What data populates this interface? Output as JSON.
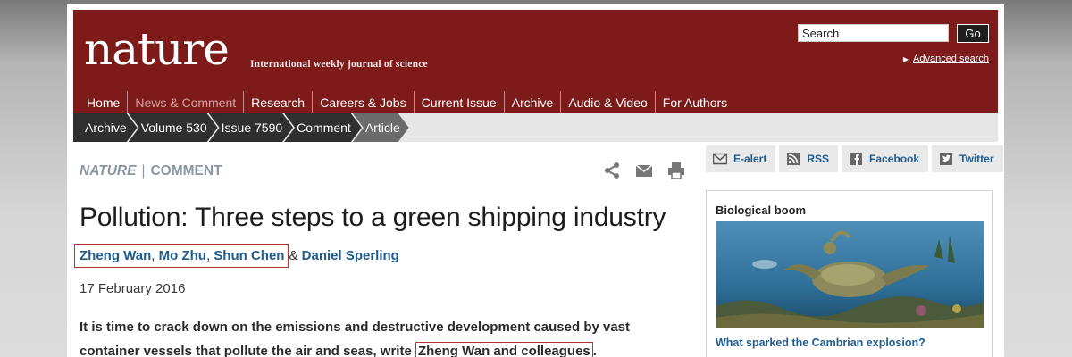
{
  "header": {
    "logo": "nature",
    "tagline": "International weekly journal of science",
    "search_placeholder": "Search",
    "go_label": "Go",
    "advanced_search": "Advanced search"
  },
  "nav": {
    "items": [
      "Home",
      "News & Comment",
      "Research",
      "Careers & Jobs",
      "Current Issue",
      "Archive",
      "Audio & Video",
      "For Authors"
    ]
  },
  "breadcrumb": [
    "Archive",
    "Volume 530",
    "Issue 7590",
    "Comment",
    "Article"
  ],
  "article": {
    "journal": "NATURE",
    "separator": "|",
    "section": "COMMENT",
    "title": "Pollution: Three steps to a green shipping industry",
    "authors": [
      "Zheng Wan",
      "Mo Zhu",
      "Shun Chen",
      "Daniel Sperling"
    ],
    "author_comma": ",",
    "author_amp": "&",
    "date": "17 February 2016",
    "standfirst_line1": "It is time to crack down on the emissions and destructive development caused by vast",
    "standfirst_line2_prefix": "container vessels that pollute the air and seas, write ",
    "standfirst_highlight": "Zheng Wan and colleagues",
    "standfirst_end": "."
  },
  "social": {
    "items": [
      {
        "label": "E-alert",
        "icon": "envelope-icon"
      },
      {
        "label": "RSS",
        "icon": "rss-icon"
      },
      {
        "label": "Facebook",
        "icon": "facebook-icon"
      },
      {
        "label": "Twitter",
        "icon": "twitter-icon"
      }
    ]
  },
  "promo": {
    "heading": "Biological boom",
    "link": "What sparked the Cambrian explosion?"
  },
  "colors": {
    "masthead": "#7d1a1a",
    "link": "#1f5c8f",
    "highlight_border": "#b83232",
    "crumb": "#2f2f2f"
  }
}
